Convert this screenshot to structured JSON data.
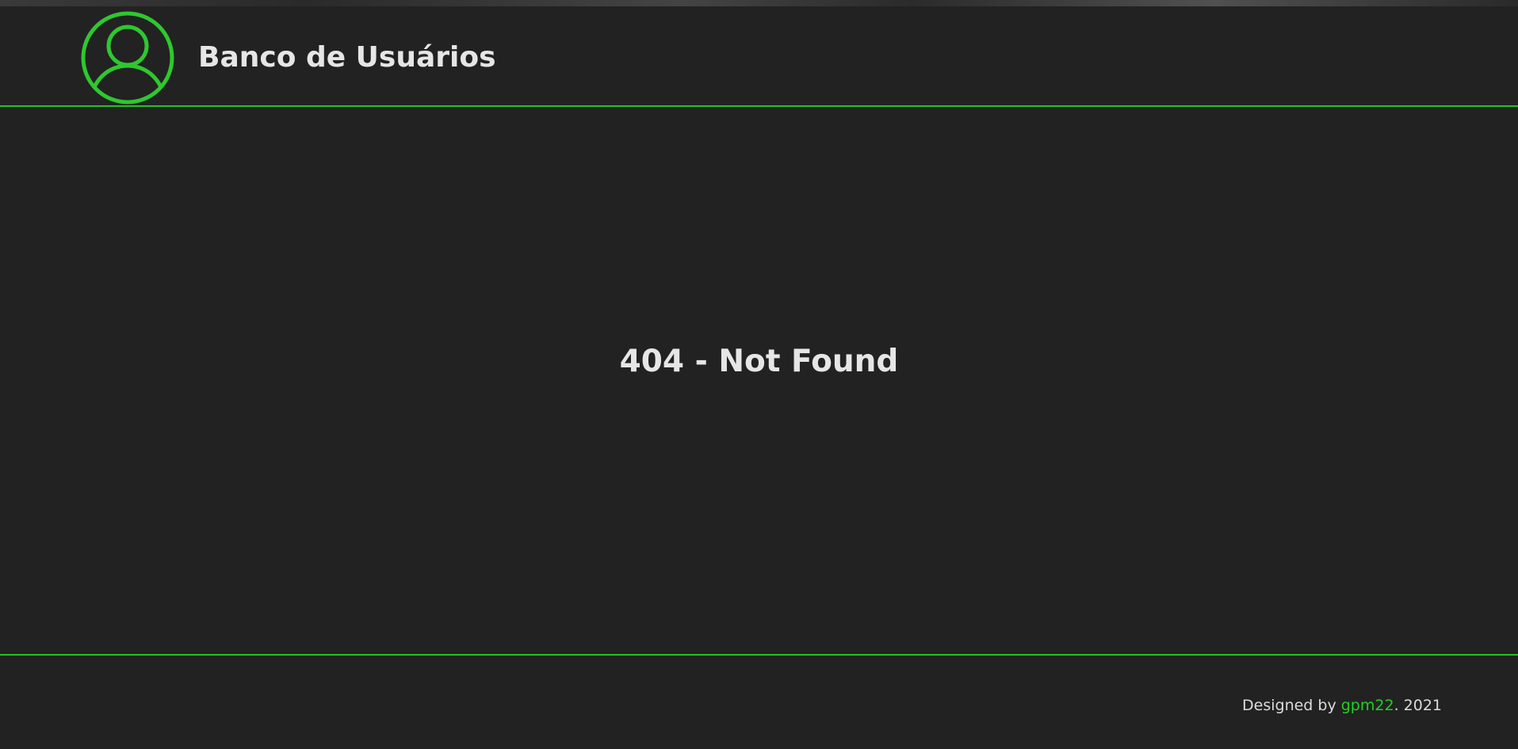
{
  "header": {
    "title": "Banco de Usuários",
    "logo_icon": "user-circle-icon",
    "accent_color": "#22c322"
  },
  "main": {
    "error_message": "404 - Not Found"
  },
  "footer": {
    "prefix": "Designed by ",
    "author": "gpm22",
    "suffix": ". 2021"
  }
}
